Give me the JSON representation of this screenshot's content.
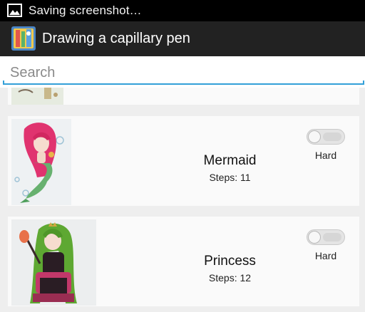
{
  "status_bar": {
    "notification_icon": "image-icon",
    "text": "Saving screenshot…"
  },
  "action_bar": {
    "app_icon": "app-icon",
    "title": "Drawing a capillary pen"
  },
  "search": {
    "placeholder": "Search",
    "value": "",
    "accent_color": "#33a0d8"
  },
  "list": {
    "items": [
      {
        "title": "Mermaid",
        "steps": "Steps: 11",
        "difficulty": "Hard",
        "toggle_on": false
      },
      {
        "title": "Princess",
        "steps": "Steps: 12",
        "difficulty": "Hard",
        "toggle_on": false
      }
    ]
  }
}
